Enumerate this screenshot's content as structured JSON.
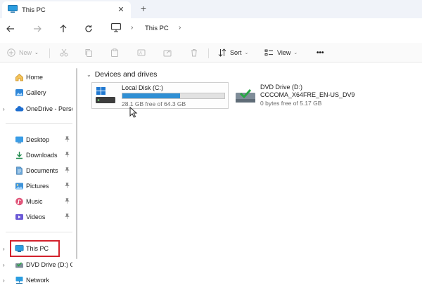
{
  "window": {
    "tab_title": "This PC",
    "close_glyph": "✕",
    "new_tab_glyph": "+"
  },
  "navigation": {
    "back_icon": "arrow-left-icon",
    "forward_icon": "arrow-right-icon",
    "up_icon": "arrow-up-icon",
    "refresh_icon": "refresh-icon",
    "breadcrumb": [
      "This PC"
    ],
    "separator": "›"
  },
  "commandbar": {
    "new_label": "New",
    "sort_label": "Sort",
    "view_label": "View",
    "more_label": "•••",
    "chevron": "⌄"
  },
  "sidebar": {
    "expand_glyph": "›",
    "pin_glyph": "📌",
    "items": [
      {
        "label": "Home",
        "icon": "home-icon"
      },
      {
        "label": "Gallery",
        "icon": "gallery-icon"
      },
      {
        "label": "OneDrive - Perso",
        "icon": "cloud-icon"
      },
      {
        "label": "Desktop",
        "icon": "desktop-icon"
      },
      {
        "label": "Downloads",
        "icon": "download-icon"
      },
      {
        "label": "Documents",
        "icon": "documents-icon"
      },
      {
        "label": "Pictures",
        "icon": "pictures-icon"
      },
      {
        "label": "Music",
        "icon": "music-icon"
      },
      {
        "label": "Videos",
        "icon": "videos-icon"
      },
      {
        "label": "This PC",
        "icon": "pc-icon"
      },
      {
        "label": "DVD Drive (D:) C",
        "icon": "dvd-icon"
      },
      {
        "label": "Network",
        "icon": "network-icon"
      }
    ]
  },
  "main": {
    "group_title": "Devices and drives",
    "drives": [
      {
        "name": "Local Disk (C:)",
        "free_text": "28.1 GB free of 64.3 GB",
        "used_fraction": 0.563
      },
      {
        "name": "DVD Drive (D:)",
        "label": "CCCOMA_X64FRE_EN-US_DV9",
        "free_text": "0 bytes free of 5.17 GB"
      }
    ]
  },
  "colors": {
    "accent": "#2f8fd4",
    "highlight_box": "#d3212c"
  }
}
